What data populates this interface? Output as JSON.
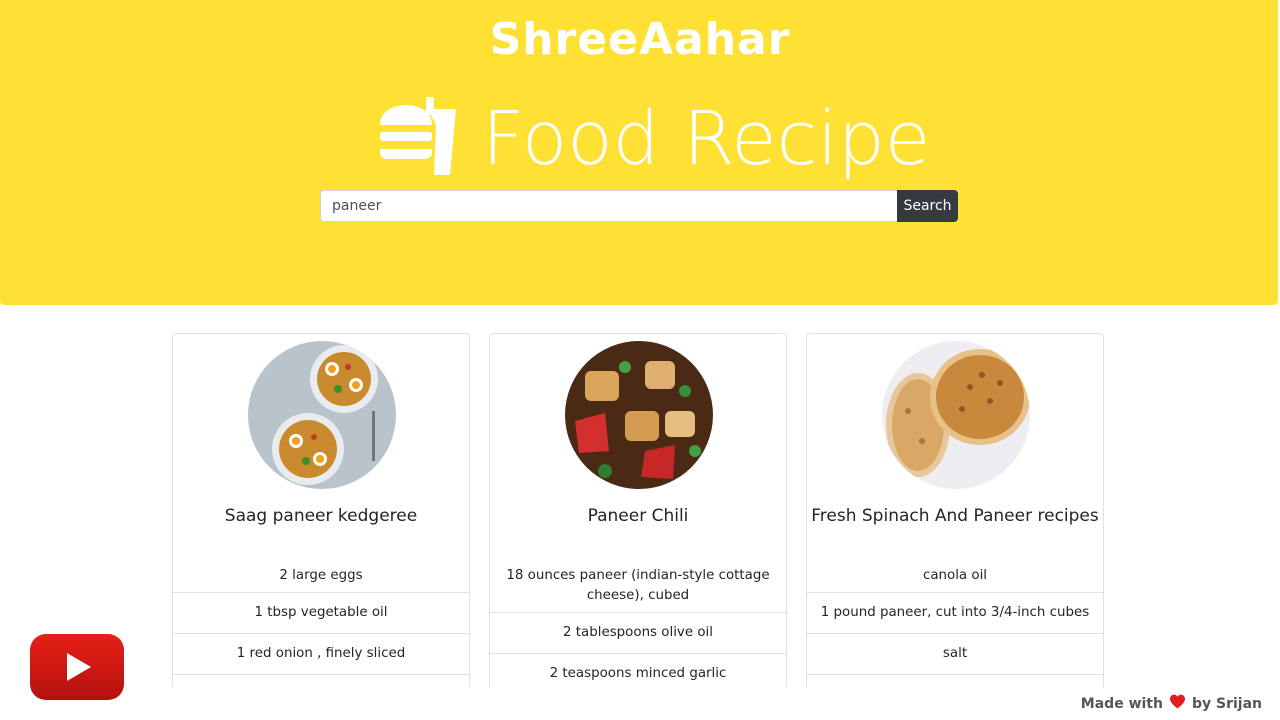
{
  "brand": "ShreeAahar",
  "hero": {
    "title": "Food Recipe",
    "icon": "burger-drink-icon"
  },
  "search": {
    "value": "paneer",
    "placeholder": "",
    "button_label": "Search"
  },
  "recipes": [
    {
      "title": "Saag paneer kedgeree",
      "ingredients": [
        "2 large eggs",
        "1 tbsp vegetable oil",
        "1 red onion , finely sliced",
        ""
      ]
    },
    {
      "title": "Paneer Chili",
      "ingredients": [
        "18 ounces paneer (indian-style cottage cheese), cubed",
        "2 tablespoons olive oil",
        "2 teaspoons minced garlic"
      ]
    },
    {
      "title": "Fresh Spinach And Paneer recipes",
      "ingredients": [
        "canola oil",
        "1 pound paneer, cut into 3/4-inch cubes",
        "salt",
        ""
      ]
    }
  ],
  "footer": {
    "prefix": "Made with",
    "suffix": "by Srijan",
    "icon": "heart-icon",
    "heart_color": "#e31b23"
  },
  "colors": {
    "hero_bg": "#ffe135",
    "button_bg": "#343a40",
    "youtube_red": "#e62117"
  },
  "social": {
    "icon": "youtube-icon"
  }
}
